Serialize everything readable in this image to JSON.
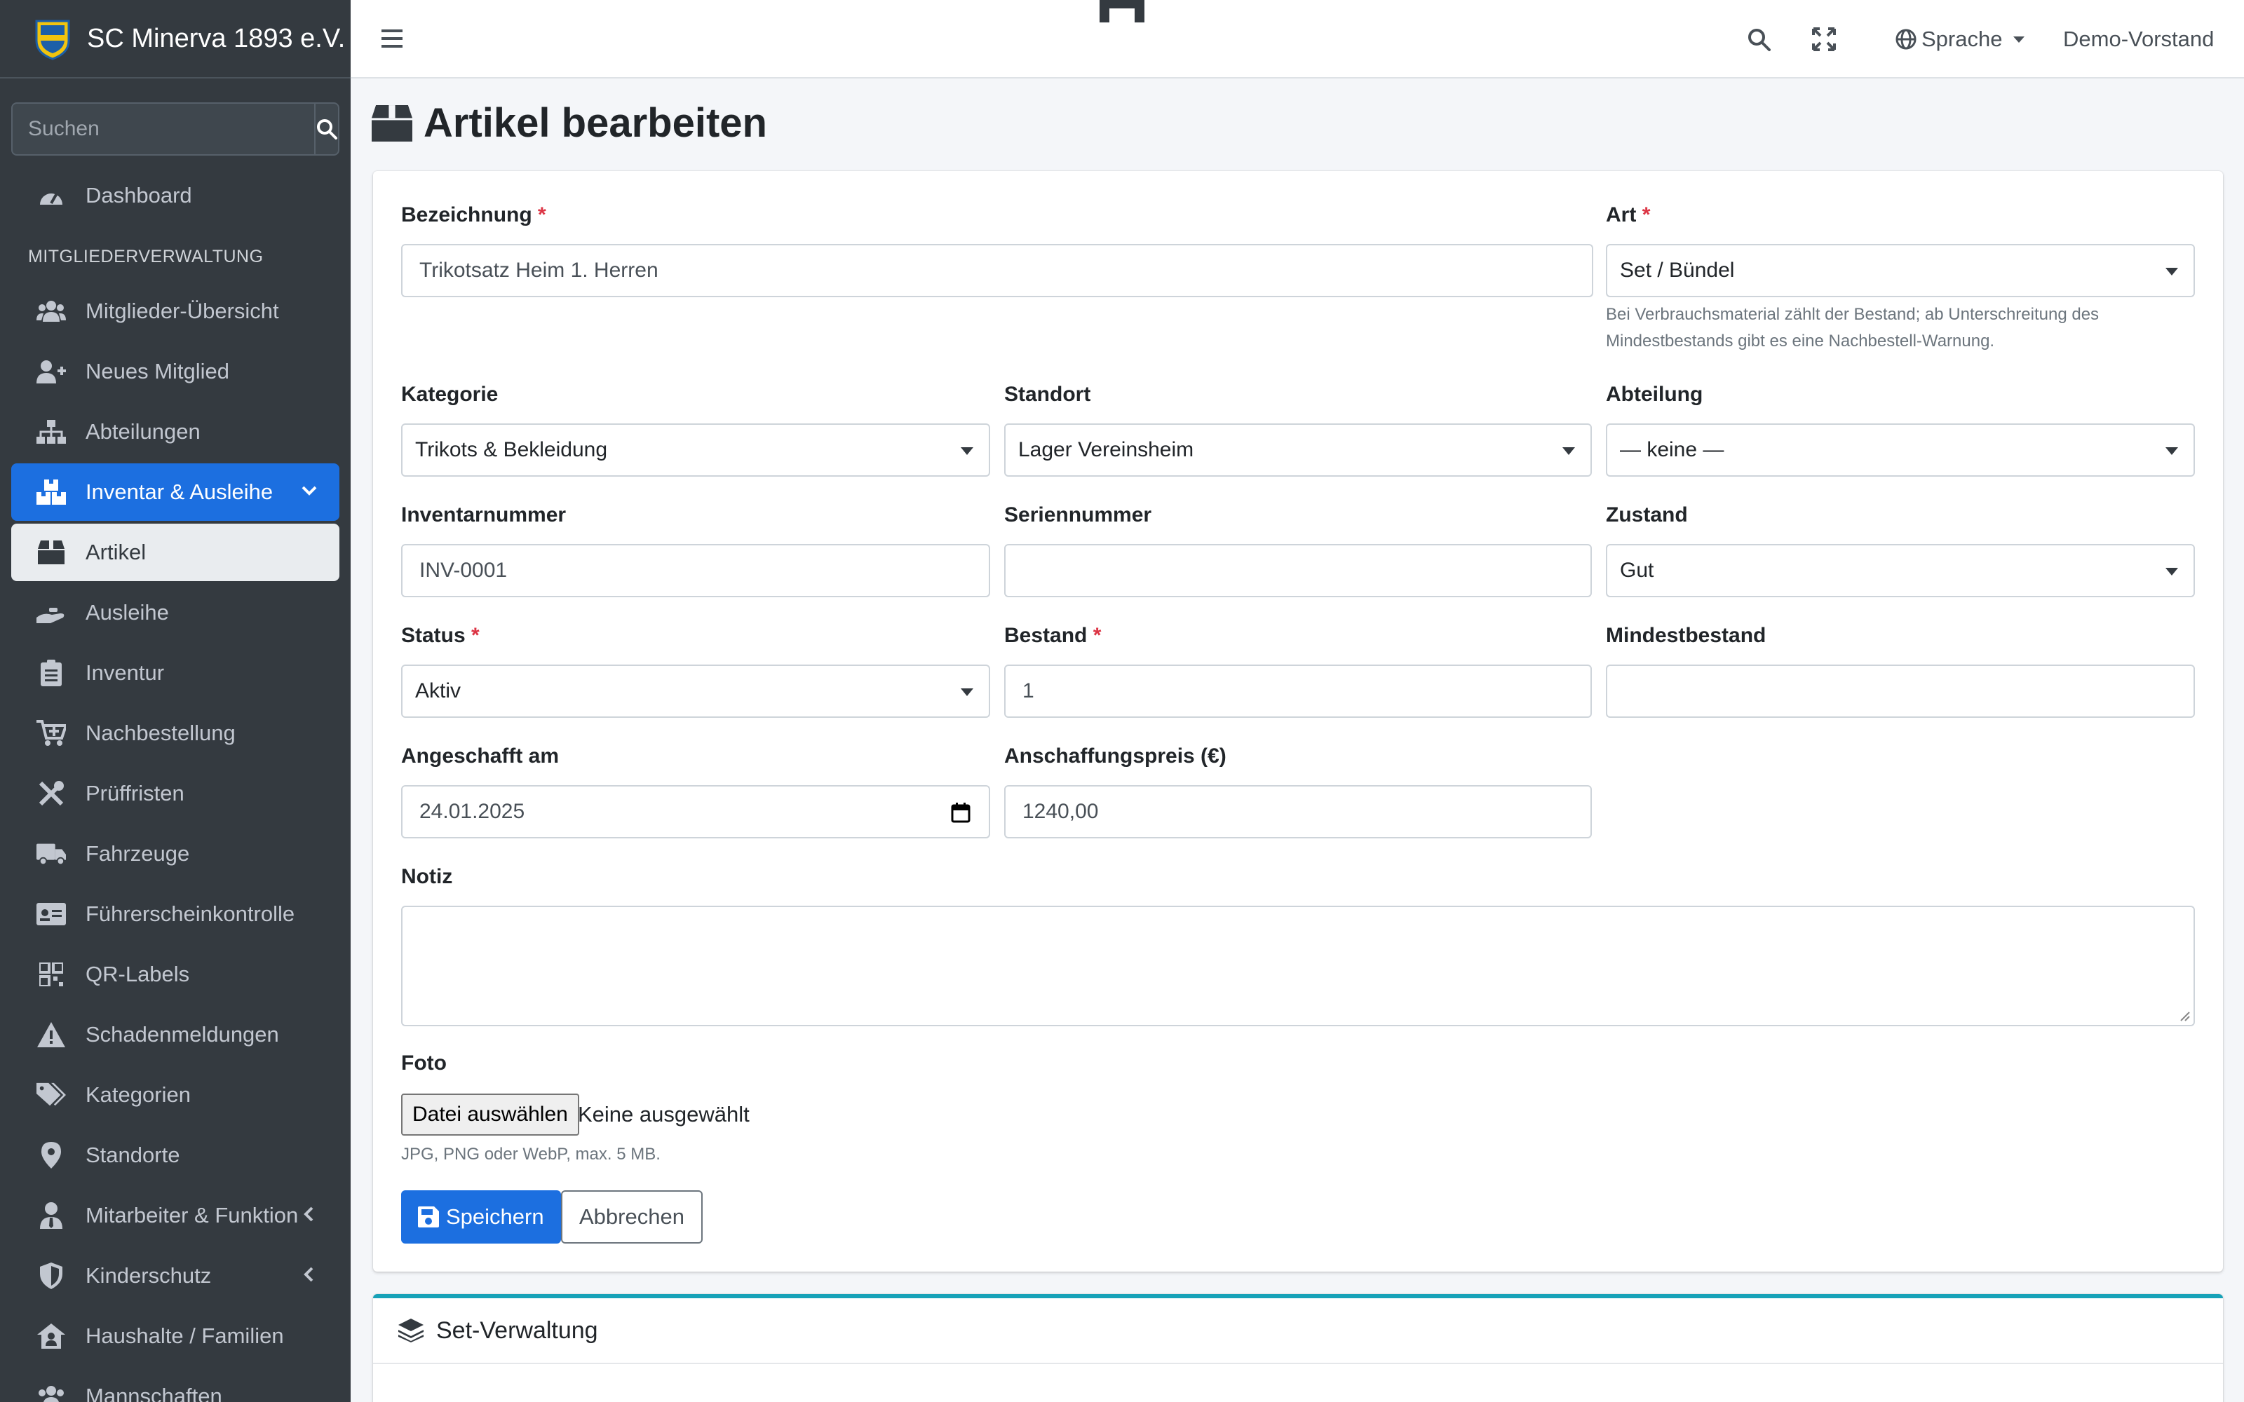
{
  "brand": {
    "name": "SC Minerva 1893 e.V."
  },
  "sidebar": {
    "search_placeholder": "Suchen",
    "dashboard": "Dashboard",
    "section_header": "MITGLIEDERVERWALTUNG",
    "items": [
      {
        "label": "Mitglieder-Übersicht",
        "icon": "users-icon"
      },
      {
        "label": "Neues Mitglied",
        "icon": "user-plus-icon"
      },
      {
        "label": "Abteilungen",
        "icon": "sitemap-icon"
      },
      {
        "label": "Inventar & Ausleihe",
        "icon": "boxes-icon"
      },
      {
        "label": "Artikel",
        "icon": "box-icon"
      },
      {
        "label": "Ausleihe",
        "icon": "hand-icon"
      },
      {
        "label": "Inventur",
        "icon": "clipboard-icon"
      },
      {
        "label": "Nachbestellung",
        "icon": "cart-icon"
      },
      {
        "label": "Prüffristen",
        "icon": "tools-icon"
      },
      {
        "label": "Fahrzeuge",
        "icon": "truck-icon"
      },
      {
        "label": "Führerscheinkontrolle",
        "icon": "id-card-icon"
      },
      {
        "label": "QR-Labels",
        "icon": "qrcode-icon"
      },
      {
        "label": "Schadenmeldungen",
        "icon": "warning-icon"
      },
      {
        "label": "Kategorien",
        "icon": "tags-icon"
      },
      {
        "label": "Standorte",
        "icon": "map-marker-icon"
      },
      {
        "label": "Mitarbeiter & Funktion",
        "icon": "user-tie-icon"
      },
      {
        "label": "Kinderschutz",
        "icon": "shield-icon"
      },
      {
        "label": "Haushalte / Familien",
        "icon": "house-user-icon"
      },
      {
        "label": "Mannschaften",
        "icon": "team-icon"
      }
    ]
  },
  "topbar": {
    "language": "Sprache",
    "user": "Demo-Vorstand"
  },
  "page": {
    "title": "Artikel bearbeiten"
  },
  "form": {
    "bezeichnung": {
      "label": "Bezeichnung",
      "value": "Trikotsatz Heim 1. Herren"
    },
    "art": {
      "label": "Art",
      "value": "Set / Bündel",
      "help": "Bei Verbrauchsmaterial zählt der Bestand; ab Unterschreitung des",
      "help2": "Mindestbestands gibt es eine Nachbestell-Warnung."
    },
    "kategorie": {
      "label": "Kategorie",
      "value": "Trikots & Bekleidung"
    },
    "standort": {
      "label": "Standort",
      "value": "Lager Vereinsheim"
    },
    "abteilung": {
      "label": "Abteilung",
      "value": "— keine —"
    },
    "inventarnummer": {
      "label": "Inventarnummer",
      "value": "INV-0001"
    },
    "seriennummer": {
      "label": "Seriennummer",
      "value": ""
    },
    "zustand": {
      "label": "Zustand",
      "value": "Gut"
    },
    "status": {
      "label": "Status",
      "value": "Aktiv"
    },
    "bestand": {
      "label": "Bestand",
      "value": "1"
    },
    "mindestbestand": {
      "label": "Mindestbestand",
      "value": ""
    },
    "angeschafft": {
      "label": "Angeschafft am",
      "value": "24.01.2025"
    },
    "preis": {
      "label": "Anschaffungspreis (€)",
      "value": "1240,00"
    },
    "notiz": {
      "label": "Notiz",
      "value": ""
    },
    "foto": {
      "label": "Foto",
      "button": "Datei auswählen",
      "status": "Keine ausgewählt",
      "help": "JPG, PNG oder WebP, max. 5 MB."
    },
    "save": "Speichern",
    "cancel": "Abbrechen",
    "required_mark": "*"
  },
  "set_card": {
    "title": "Set-Verwaltung"
  },
  "colors": {
    "primary": "#1c6fe0",
    "sidebar": "#343a40",
    "accent_teal": "#17a2b8"
  }
}
